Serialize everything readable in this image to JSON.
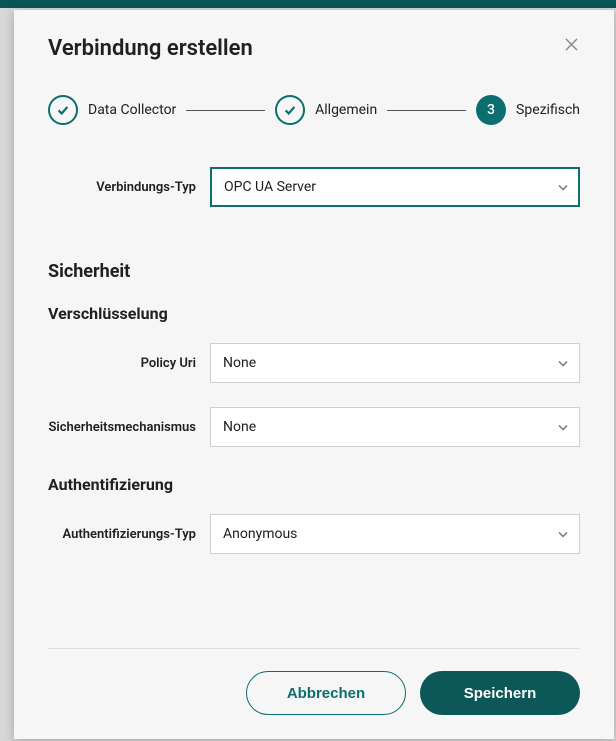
{
  "modal": {
    "title": "Verbindung erstellen"
  },
  "stepper": {
    "steps": [
      {
        "label": "Data Collector",
        "state": "done"
      },
      {
        "label": "Allgemein",
        "state": "done"
      },
      {
        "label": "Spezifisch",
        "state": "active",
        "number": "3"
      }
    ]
  },
  "fields": {
    "connection_type": {
      "label": "Verbindungs-Typ",
      "value": "OPC UA Server"
    },
    "policy_uri": {
      "label": "Policy Uri",
      "value": "None"
    },
    "security_mech": {
      "label": "Sicherheitsmechanismus",
      "value": "None"
    },
    "auth_type": {
      "label": "Authentifizierungs-Typ",
      "value": "Anonymous"
    }
  },
  "sections": {
    "security": "Sicherheit",
    "encryption": "Verschlüsselung",
    "auth": "Authentifizierung"
  },
  "buttons": {
    "cancel": "Abbrechen",
    "save": "Speichern"
  }
}
